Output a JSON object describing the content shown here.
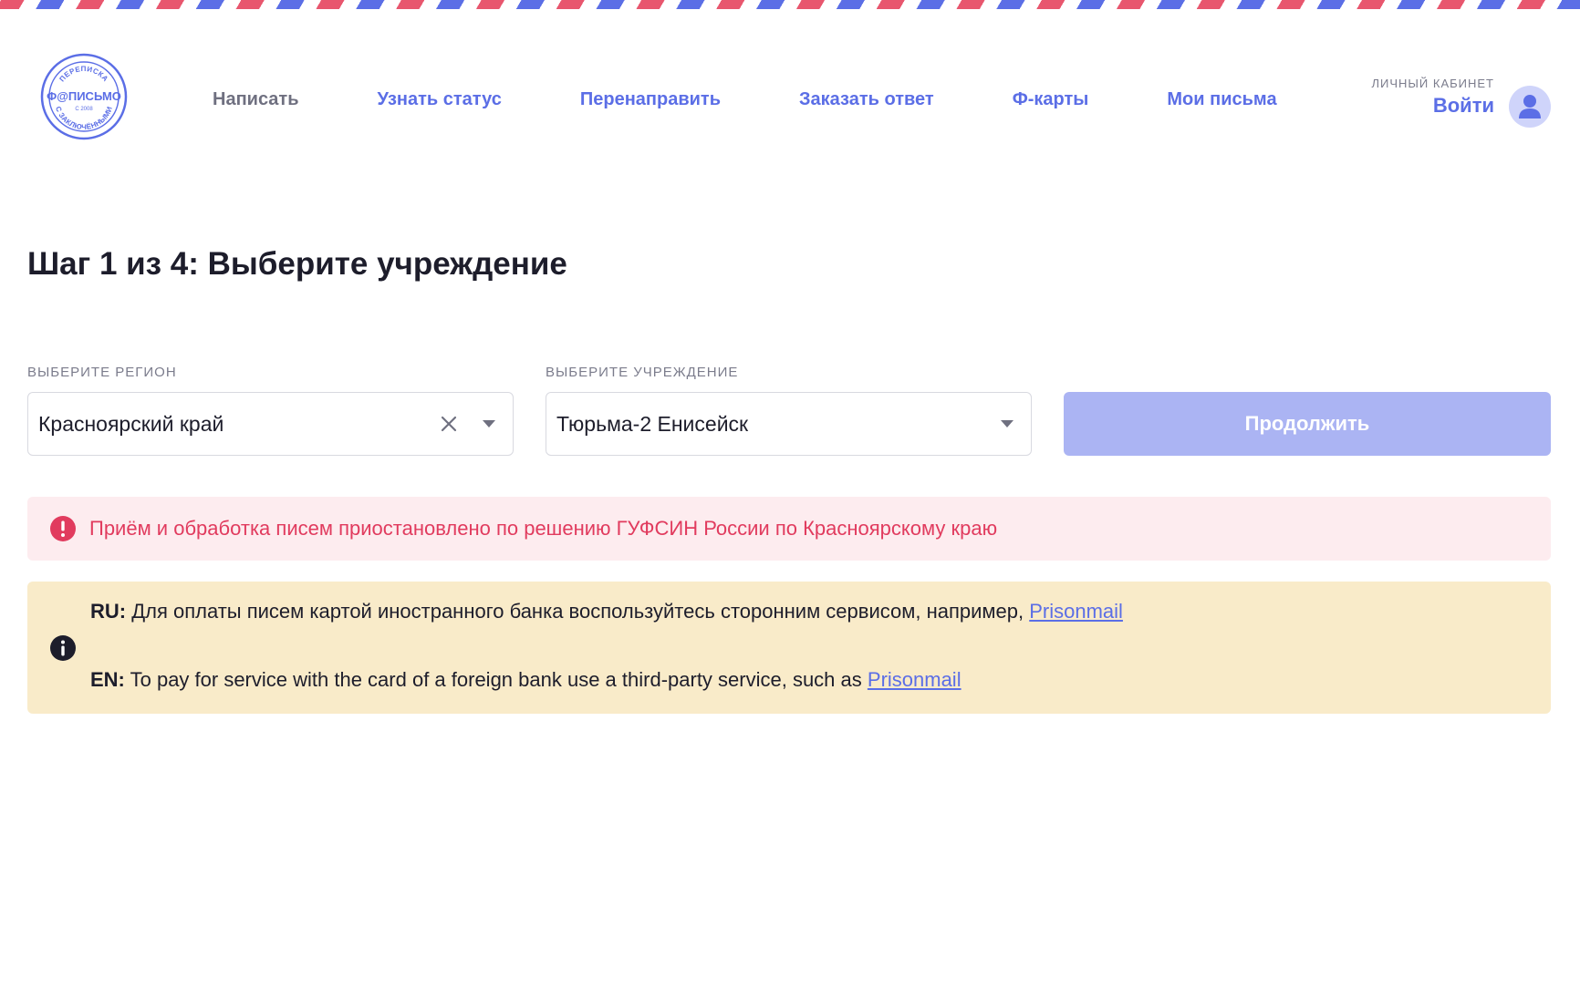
{
  "header": {
    "logo": {
      "top_text": "ПЕРЕПИСКА",
      "main_text": "Ф@ПИСЬМО",
      "since_text": "С 2008",
      "bottom_text": "С ЗАКЛЮЧЁННЫМИ"
    },
    "nav": [
      {
        "label": "Написать"
      },
      {
        "label": "Узнать статус"
      },
      {
        "label": "Перенаправить"
      },
      {
        "label": "Заказать ответ"
      },
      {
        "label": "Ф-карты"
      },
      {
        "label": "Мои письма"
      }
    ],
    "account": {
      "caption": "ЛИЧНЫЙ КАБИНЕТ",
      "login_label": "Войти",
      "avatar_icon": "user-icon"
    }
  },
  "main": {
    "title": "Шаг 1 из 4: Выберите учреждение",
    "region": {
      "label": "ВЫБЕРИТЕ РЕГИОН",
      "value": "Красноярский край"
    },
    "institution": {
      "label": "ВЫБЕРИТЕ УЧРЕЖДЕНИЕ",
      "value": "Тюрьма-2 Енисейск"
    },
    "continue_label": "Продолжить",
    "error_alert": {
      "icon": "exclamation-circle-icon",
      "text": "Приём и обработка писем приостановлено по решению ГУФСИН России по Красноярскому краю"
    },
    "info_alert": {
      "icon": "info-circle-icon",
      "ru_prefix": "RU:",
      "ru_text": " Для оплаты писем картой иностранного банка воспользуйтесь сторонним сервисом, например, ",
      "ru_link": "Prisonmail",
      "en_prefix": "EN:",
      "en_text": " To pay for service with the card of a foreign bank use a third-party service, such as ",
      "en_link": "Prisonmail"
    }
  },
  "colors": {
    "accent": "#5b6ee6",
    "error": "#e13b5e",
    "error_bg": "#fdecef",
    "info_bg": "#f9ebc9",
    "button_disabled": "#abb4f3",
    "airmail_red": "#e8566e"
  }
}
